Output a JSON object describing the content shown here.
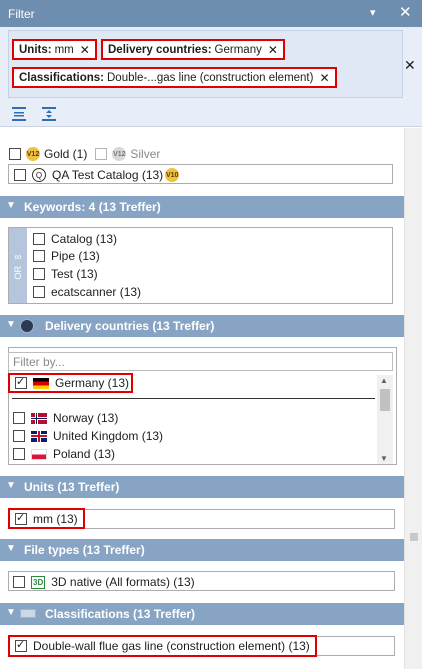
{
  "window": {
    "title": "Filter"
  },
  "chips": [
    {
      "key": "Units:",
      "value": "mm"
    },
    {
      "key": "Delivery countries:",
      "value": "Germany"
    },
    {
      "key": "Classifications:",
      "value": "Double-...gas line (construction element)"
    }
  ],
  "top_items": {
    "gold_badge": "V12",
    "gold_label": "Gold (1)",
    "silver_badge": "V12",
    "silver_label": "Silver",
    "catalog_label": "QA Test Catalog (13)",
    "catalog_badge": "V10"
  },
  "keywords": {
    "header": "Keywords: 4 (13 Treffer)",
    "operator": "OR",
    "items": [
      "Catalog (13)",
      "Pipe (13)",
      "Test (13)",
      "ecatscanner (13)"
    ]
  },
  "delivery": {
    "header": "Delivery countries (13 Treffer)",
    "filter_placeholder": "Filter by...",
    "selected": "Germany (13)",
    "items": [
      "Norway (13)",
      "United Kingdom (13)",
      "Poland (13)"
    ]
  },
  "units": {
    "header": "Units (13 Treffer)",
    "selected": "mm (13)"
  },
  "filetypes": {
    "header": "File types (13 Treffer)",
    "badge": "3D",
    "item": "3D native (All formats) (13)"
  },
  "classifications": {
    "header": "Classifications (13 Treffer)",
    "selected": "Double-wall flue gas line (construction element) (13)"
  },
  "colors": {
    "titlebar": "#6e8eb0",
    "section_header": "#87a4c4",
    "highlight": "#e00000"
  }
}
